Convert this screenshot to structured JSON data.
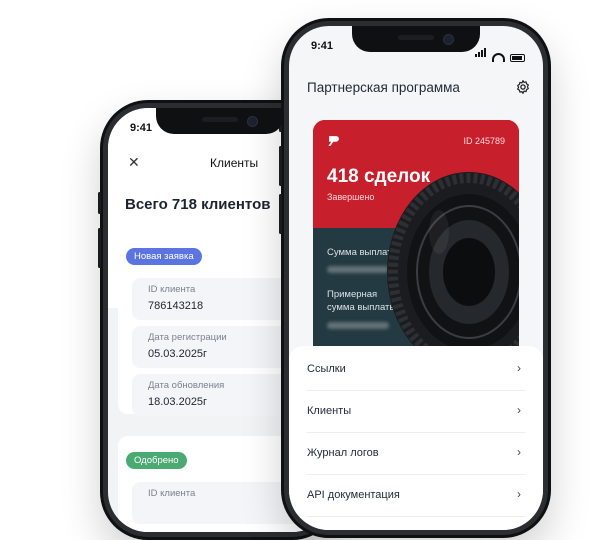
{
  "left_phone": {
    "time": "9:41",
    "header_title": "Клиенты",
    "total": "Всего 718 клиентов",
    "card1": {
      "status": "Новая заявка",
      "fields": [
        {
          "label": "ID клиента",
          "value": "786143218"
        },
        {
          "label": "Дата регистрации",
          "value": "05.03.2025г"
        },
        {
          "label": "Дата обновления",
          "value": "18.03.2025г"
        }
      ]
    },
    "card2": {
      "status": "Одобрено",
      "fields": [
        {
          "label": "ID клиента",
          "value": ""
        }
      ]
    }
  },
  "right_phone": {
    "time": "9:41",
    "title": "Партнерская программа",
    "promo": {
      "id": "ID 245789",
      "deals": "418 сделок",
      "deals_status": "Завершено",
      "payout_label": "Сумма выплаты",
      "estimated_payout_label": "Примерная сумма выплаты"
    },
    "menu": [
      {
        "label": "Ссылки"
      },
      {
        "label": "Клиенты"
      },
      {
        "label": "Журнал логов"
      },
      {
        "label": "API документация"
      }
    ]
  },
  "colors": {
    "brand_red": "#c81f2d",
    "dark_teal": "#243a42",
    "badge_blue": "#5b74e0",
    "badge_green": "#4aaa72"
  },
  "icons": [
    "close-icon",
    "gear-icon",
    "chevron-right-icon",
    "logo-icon",
    "tire-image"
  ]
}
